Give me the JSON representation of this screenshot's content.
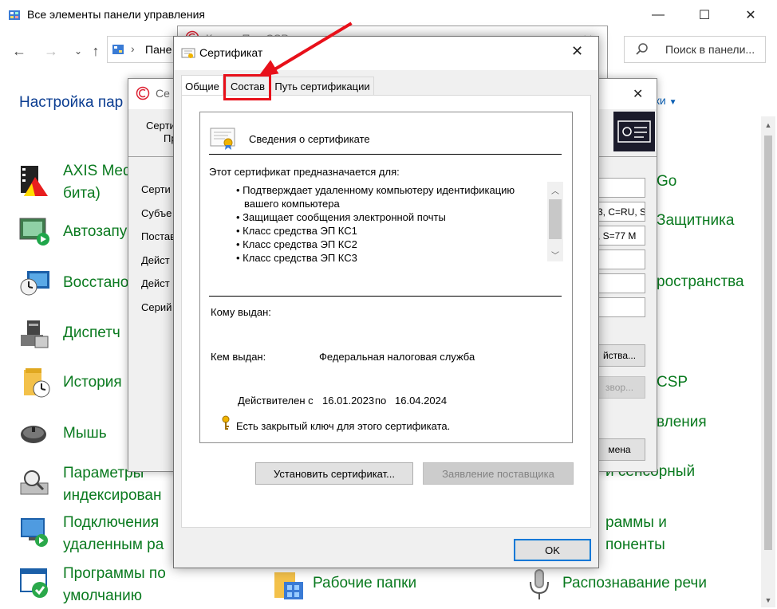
{
  "control_panel": {
    "title": "Все элементы панели управления",
    "address": "Пане",
    "search_placeholder": "Поиск в панели...",
    "heading": "Настройка пар",
    "view_label": "ачки",
    "items_left": [
      {
        "label": "AXIS Med",
        "label2": "бита)",
        "icon": "axis-media-icon"
      },
      {
        "label": "Автозапу",
        "label2": "",
        "icon": "autoplay-icon"
      },
      {
        "label": "Восстано",
        "label2": "",
        "icon": "recovery-icon"
      },
      {
        "label": "Диспетч",
        "label2": "",
        "icon": "device-manager-icon"
      },
      {
        "label": "История",
        "label2": "",
        "icon": "file-history-icon"
      },
      {
        "label": "Мышь",
        "label2": "",
        "icon": "mouse-icon"
      },
      {
        "label": "Параметры",
        "label2": "индексирован",
        "icon": "indexing-icon"
      },
      {
        "label": "Подключения",
        "label2": "удаленным ра",
        "icon": "remote-connection-icon"
      },
      {
        "label": "Программы по",
        "label2": "умолчанию",
        "icon": "default-programs-icon"
      }
    ],
    "items_right": [
      {
        "label": "Go"
      },
      {
        "label": "Защитника"
      },
      {
        "label": "ространства"
      },
      {
        "label": "CSP"
      },
      {
        "label": "вления"
      },
      {
        "label": "и сенсорный"
      },
      {
        "label": "раммы и"
      },
      {
        "label": "поненты"
      }
    ],
    "items_bottom": [
      {
        "label": "Рабочие папки",
        "icon": "work-folders-icon"
      },
      {
        "label": "Распознавание речи",
        "icon": "speech-recognition-icon"
      }
    ]
  },
  "kriptopro": {
    "title": "КриптоПро CSP"
  },
  "mid_window": {
    "title_partial": "Се",
    "header_line1": "Серти",
    "header_line2": "Пр",
    "labels": [
      "Серти",
      "Субъе",
      "Постав",
      "Дейст",
      "Дейст",
      "Серий"
    ],
    "fields": [
      "",
      "3, C=RU, S",
      ", S=77 M",
      "",
      "",
      ""
    ],
    "btn_properties": "йства...",
    "btn_browse": "звор...",
    "btn_cancel": "мена"
  },
  "dialog": {
    "title": "Сертификат",
    "tabs": [
      "Общие",
      "Состав",
      "Путь сертификации"
    ],
    "info_header": "Сведения о сертификате",
    "purpose_intro": "Этот сертификат предназначается для:",
    "purposes": [
      "• Подтверждает удаленному компьютеру идентификацию",
      "вашего компьютера",
      "• Защищает сообщения электронной почты",
      "• Класс средства ЭП КС1",
      "• Класс средства ЭП КС2",
      "• Класс средства ЭП КС3"
    ],
    "issued_to_label": "Кому выдан:",
    "issued_to_value": "",
    "issued_by_label": "Кем выдан:",
    "issued_by_value": "Федеральная налоговая служба",
    "valid_from_label": "Действителен с",
    "valid_from": "16.01.2023",
    "valid_to_label": "по",
    "valid_to": "16.04.2024",
    "private_key_note": "Есть закрытый ключ для этого сертификата.",
    "install_button": "Установить сертификат...",
    "issuer_statement_button": "Заявление поставщика",
    "ok_button": "OK"
  },
  "colors": {
    "annotation": "#e8101a",
    "link_green": "#0a7a1f",
    "heading_blue": "#0b3d91"
  }
}
